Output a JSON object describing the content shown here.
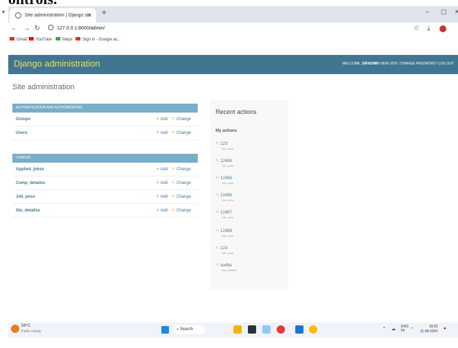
{
  "doc_heading": "ontrols.",
  "browser": {
    "tab_title": "Site administration | Django site admin",
    "tab_title_shown": "Site administration | Django sit",
    "url": "127.0.0.1:8000/admin/",
    "bookmarks": [
      {
        "label": "Gmail",
        "icon": "gmail-icon",
        "color": "#d93025"
      },
      {
        "label": "YouTube",
        "icon": "youtube-icon",
        "color": "#ff0000"
      },
      {
        "label": "Maps",
        "icon": "maps-icon",
        "color": "#34a853"
      },
      {
        "label": "Sign in - Google ac...",
        "icon": "gmail-icon",
        "color": "#d93025"
      }
    ]
  },
  "admin": {
    "branding": "Django administration",
    "user_tools": {
      "welcome": "WELCOME,",
      "username": "SIRADMIN",
      "links": "VIEW SITE / CHANGE PASSWORD / LOG OUT"
    },
    "page_title": "Site administration",
    "add_label": "Add",
    "change_label": "Change",
    "modules": [
      {
        "caption": "Authentication and Authorization",
        "models": [
          "Groups",
          "Users"
        ]
      },
      {
        "caption": "Campus",
        "models": [
          "Applied_jobss",
          "Comp_detailss",
          "Job_poss",
          "Stu_detailss"
        ]
      }
    ],
    "recent": {
      "title": "Recent actions",
      "subtitle": "My actions",
      "actions": [
        {
          "name": "123",
          "type": "Job_poss"
        },
        {
          "name": "12458",
          "type": "Job_poss"
        },
        {
          "name": "12456",
          "type": "Job_poss"
        },
        {
          "name": "12456",
          "type": "Job_poss"
        },
        {
          "name": "12457",
          "type": "Job_poss"
        },
        {
          "name": "12458",
          "type": "Job_poss"
        },
        {
          "name": "123",
          "type": "Job_poss"
        },
        {
          "name": "sudha",
          "type": "Stu_detailss"
        }
      ]
    }
  },
  "taskbar": {
    "temperature": "34°C",
    "weather": "Partly cloudy",
    "search": "Search",
    "language": "ENG",
    "region": "IN",
    "time": "19:33",
    "date": "11-04-2024"
  },
  "colors": {
    "header": "#417690",
    "branding": "#f5dd5d",
    "caption": "#79aec8",
    "link": "#417690",
    "add": "#70bf2b",
    "change": "#efb80b"
  }
}
